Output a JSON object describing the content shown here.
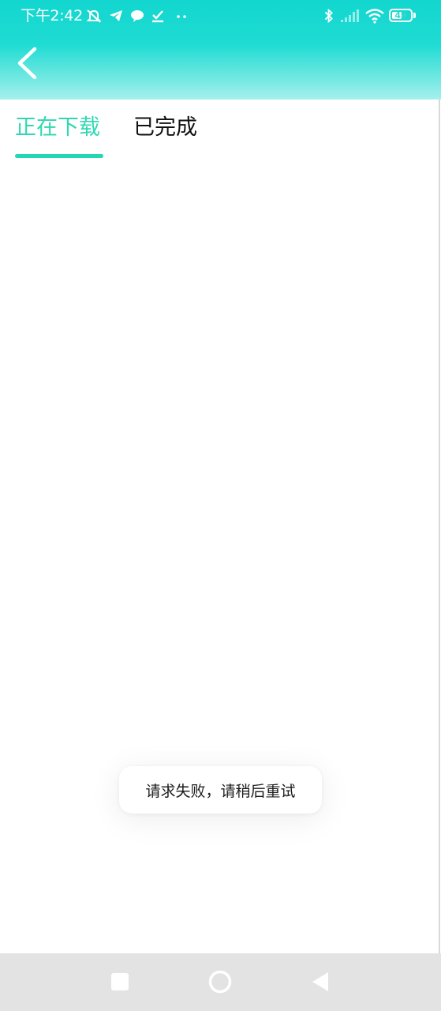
{
  "status_bar": {
    "time": "下午2:42",
    "battery_level": "49",
    "icons": [
      "mute-icon",
      "telegram-icon",
      "chat-bubble-icon",
      "download-done-icon",
      "more-dots-icon",
      "bluetooth-icon",
      "signal-icon",
      "wifi-icon",
      "battery-icon"
    ]
  },
  "header": {
    "back_icon": "chevron-left-icon"
  },
  "tabs": [
    {
      "label": "正在下载",
      "active": true
    },
    {
      "label": "已完成",
      "active": false
    }
  ],
  "toast": {
    "message": "请求失败，请稍后重试"
  },
  "nav_bar": {
    "buttons": [
      "recents-icon",
      "home-icon",
      "back-triangle-icon"
    ]
  },
  "colors": {
    "header_gradient_top": "#12d6cf",
    "header_gradient_bottom": "#a6f0ec",
    "accent": "#2fd8b2",
    "nav_bar": "#e3e3e3"
  }
}
